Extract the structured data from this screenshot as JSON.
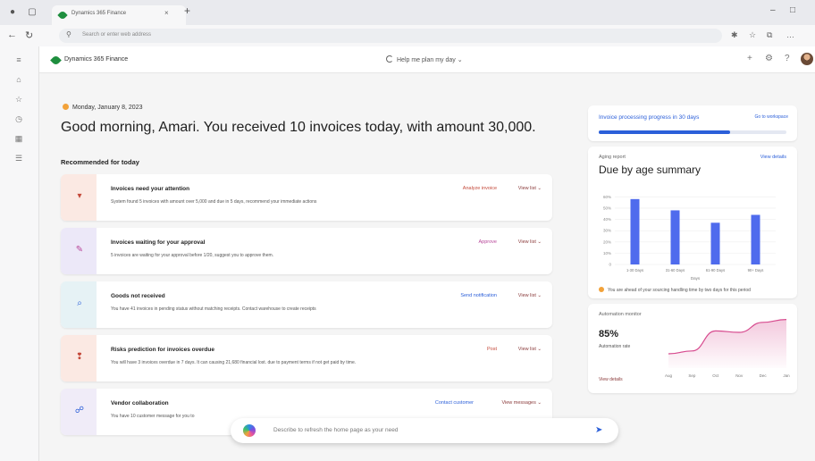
{
  "browser": {
    "tab_title": "Dynamics 365 Finance",
    "tab_close": "×",
    "new_tab": "+",
    "address_placeholder": "Search or enter web address",
    "win_min": "–",
    "win_max": "□"
  },
  "app": {
    "name": "Dynamics 365 Finance",
    "plan_prompt": "Help me plan my day",
    "plan_chevron": "⌄"
  },
  "header": {
    "date": "Monday, January 8, 2023",
    "greeting": "Good morning, Amari. You received 10 invoices today, with amount 30,000.",
    "recommended": "Recommended for today"
  },
  "cards": [
    {
      "title": "Invoices need your attention",
      "body": "System found 5 invoices with amount over 5,000 and due in 5 days, recommend your immediate actions",
      "action": "Analyze invoice",
      "view": "View list",
      "band_color": "#fbe9e3",
      "accent": "#c4493a",
      "icon": "filter-icon"
    },
    {
      "title": "Invoices waiting for your approval",
      "body": "5 invoices are waiting for your approval before 1/20, suggest you to approve them.",
      "action": "Approve",
      "view": "View list",
      "band_color": "#ece8f8",
      "accent": "#b8489a",
      "icon": "approval-icon"
    },
    {
      "title": "Goods not received",
      "body": "You have 41 invoices in pending status without matching receipts. Contact warehouse to create receipts",
      "action": "Send notification",
      "view": "View list",
      "band_color": "#e6f2f5",
      "accent": "#2b5fd9",
      "icon": "search-icon"
    },
    {
      "title": "Risks prediction for invoices overdue",
      "body": "You will have 3 invoices overdue in 7 days. It can causing 21,680 financial lost. due to payment terms if not get paid by time.",
      "action": "Post",
      "view": "View list",
      "band_color": "#fbe9e3",
      "accent": "#c4493a",
      "icon": "risk-icon"
    },
    {
      "title": "Vendor collaboration",
      "body": "You have 10 customer message for you to",
      "action": "Contact customer",
      "view": "View messages",
      "band_color": "#f0ecf8",
      "accent": "#2b5fd9",
      "icon": "collab-icon"
    }
  ],
  "progress": {
    "title": "Invoice processing progress in",
    "title_highlight": "30 days",
    "link": "Go to workspace",
    "value_pct": 70
  },
  "aging": {
    "small": "Aging report",
    "title": "Due by age summary",
    "link": "View details",
    "note": "You are ahead of your sourcing handling time by two days for this period"
  },
  "automation": {
    "small": "Automation monitor",
    "pct": "85%",
    "label": "Automation rate",
    "link": "View details"
  },
  "prompt": {
    "placeholder": "Describe to refresh the home page as your need",
    "send": "➤"
  },
  "chart_data": [
    {
      "type": "bar",
      "title": "Due by age summary",
      "categories": [
        "1-30 Days",
        "31-60 Days",
        "61-90 Days",
        "90+ Days"
      ],
      "series": [
        {
          "values": [
            58,
            48,
            37,
            44
          ]
        }
      ],
      "y_ticks": [
        "60%",
        "50%",
        "40%",
        "30%",
        "20%",
        "10%",
        "0"
      ],
      "ylim": [
        0,
        65
      ],
      "xlabel": "Days",
      "color": "#4f6bed",
      "grid": true
    },
    {
      "type": "area",
      "categories": [
        "Aug",
        "Sep",
        "Oct",
        "Nov",
        "Dec",
        "Jan"
      ],
      "series": [
        {
          "values": [
            40,
            44,
            72,
            70,
            84,
            88
          ]
        }
      ],
      "ylim": [
        20,
        100
      ],
      "color": "#d74b8f"
    }
  ]
}
